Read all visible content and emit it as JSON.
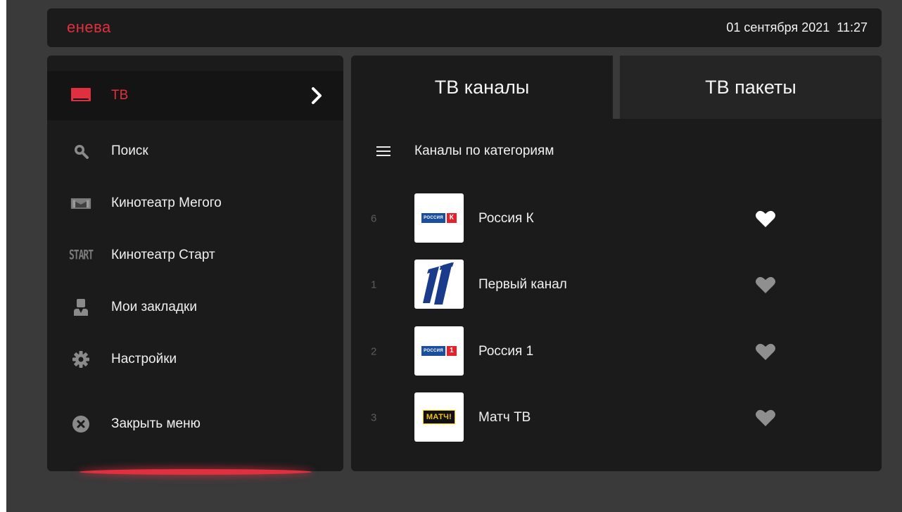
{
  "app": {
    "brand": "енева",
    "date": "01 сентября 2021",
    "time": "11:27"
  },
  "menu": {
    "items": [
      {
        "label": "ТВ",
        "icon": "tv-icon",
        "active": true
      },
      {
        "label": "Поиск",
        "icon": "search-icon"
      },
      {
        "label": "Кинотеатр Мегого",
        "icon": "megogo-icon"
      },
      {
        "label": "Кинотеатр Старт",
        "icon": "start-icon",
        "icon_text": "START"
      },
      {
        "label": "Мои закладки",
        "icon": "user-bookmark-icon"
      },
      {
        "label": "Настройки",
        "icon": "gear-icon"
      },
      {
        "label": "Закрыть меню",
        "icon": "close-circle-icon"
      }
    ]
  },
  "tabs": [
    {
      "label": "ТВ каналы",
      "active": true
    },
    {
      "label": "ТВ пакеты",
      "active": false
    }
  ],
  "categories": {
    "label": "Каналы по категориям",
    "icon": "hamburger-icon"
  },
  "channels": [
    {
      "number": "6",
      "name": "Россия К",
      "logo_text": "РОССИЯ",
      "logo_mark": "К",
      "favorite": true
    },
    {
      "number": "1",
      "name": "Первый канал",
      "logo_mark": "1",
      "favorite": false
    },
    {
      "number": "2",
      "name": "Россия 1",
      "logo_text": "РОССИЯ",
      "logo_mark": "1",
      "favorite": false
    },
    {
      "number": "3",
      "name": "Матч ТВ",
      "logo_text": "МАТЧ!",
      "favorite": false
    }
  ],
  "colors": {
    "accent": "#e0303f",
    "background": "#3a3a3b",
    "panel": "#1b1b1c",
    "fav_active": "#ffffff",
    "fav_inactive": "#8f8f8f"
  }
}
